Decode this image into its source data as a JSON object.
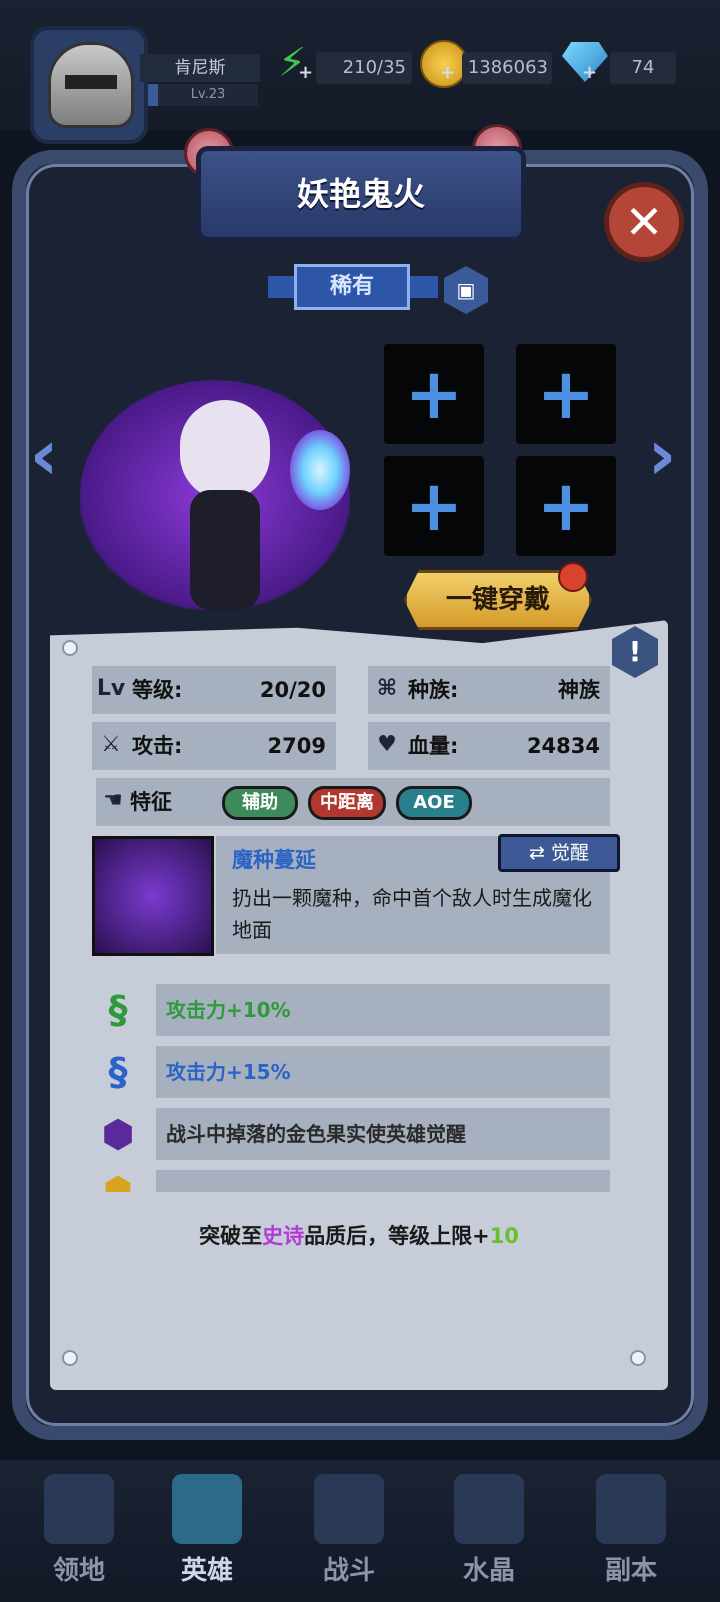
{
  "player": {
    "name": "肯尼斯",
    "level": "Lv.23"
  },
  "resources": {
    "energy": "210/35",
    "gold": "1386063",
    "gems": "74",
    "add_label": "+"
  },
  "hero": {
    "title": "妖艳鬼火",
    "rarity": "稀有",
    "equip_button": "一键穿戴",
    "stats": {
      "level_label": "等级:",
      "level_value": "20/20",
      "race_label": "种族:",
      "race_value": "神族",
      "attack_label": "攻击:",
      "attack_value": "2709",
      "hp_label": "血量:",
      "hp_value": "24834"
    },
    "traits_label": "特征",
    "traits": [
      "辅助",
      "中距离",
      "AOE"
    ],
    "skill": {
      "name": "魔种蔓延",
      "description": "扔出一颗魔种，命中首个敌人时生成魔化地面",
      "awaken_label": "觉醒"
    },
    "bonuses": [
      "攻击力+10%",
      "攻击力+15%",
      "战斗中掉落的金色果实使英雄觉醒"
    ],
    "notice": {
      "prefix": "突破至",
      "quality": "史诗",
      "middle": "品质后，等级上限+",
      "amount": "10"
    }
  },
  "nav": [
    "领地",
    "英雄",
    "战斗",
    "水晶",
    "副本"
  ],
  "colors": {
    "green_bonus": "#2e9a3a",
    "blue_bonus": "#2b63c6",
    "epic": "#b43ad8",
    "plus_green": "#6bbf2a"
  }
}
